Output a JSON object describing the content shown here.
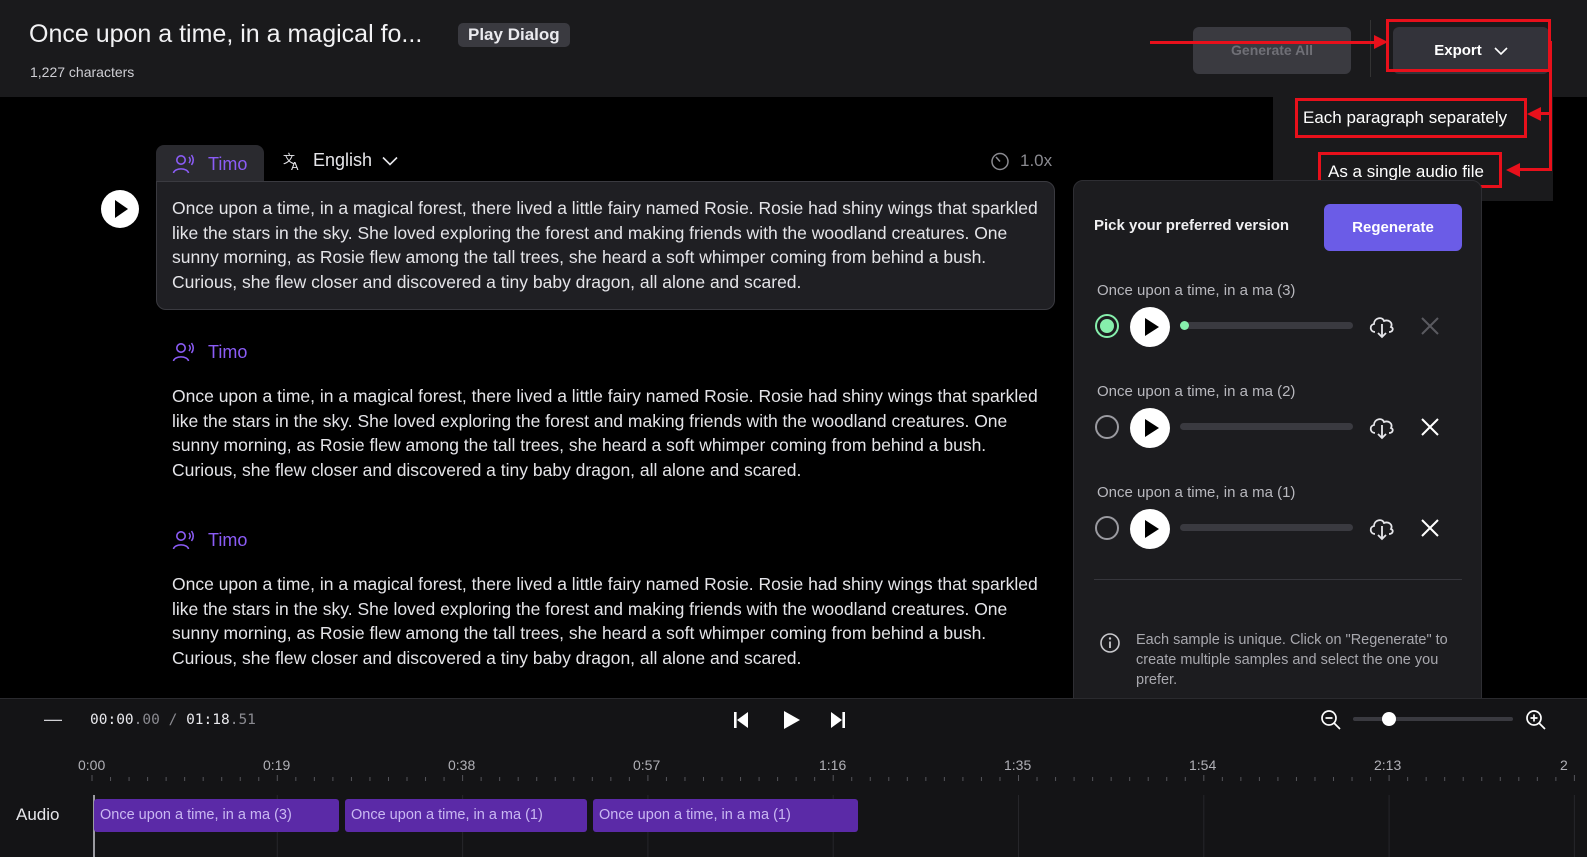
{
  "header": {
    "title": "Once upon a time, in a magical fo...",
    "badge": "Play Dialog",
    "char_count": "1,227 characters",
    "generate_all": "Generate All",
    "export": "Export"
  },
  "export_menu": {
    "items": [
      "Each paragraph separately",
      "As a single audio file"
    ]
  },
  "editor": {
    "language": "English",
    "speed": "1.0x",
    "paragraphs": [
      {
        "speaker": "Timo",
        "text": "Once upon a time, in a magical forest, there lived a little fairy named Rosie. Rosie had shiny wings that sparkled like the stars in the sky. She loved exploring the forest and making friends with the woodland creatures. One sunny morning, as Rosie flew among the tall trees, she heard a soft whimper coming from behind a bush. Curious, she flew closer and discovered a tiny baby dragon, all alone and scared."
      },
      {
        "speaker": "Timo",
        "text": "Once upon a time, in a magical forest, there lived a little fairy named Rosie. Rosie had shiny wings that sparkled like the stars in the sky. She loved exploring the forest and making friends with the woodland creatures. One sunny morning, as Rosie flew among the tall trees, she heard a soft whimper coming from behind a bush. Curious, she flew closer and discovered a tiny baby dragon, all alone and scared."
      },
      {
        "speaker": "Timo",
        "text": "Once upon a time, in a magical forest, there lived a little fairy named Rosie. Rosie had shiny wings that sparkled like the stars in the sky. She loved exploring the forest and making friends with the woodland creatures. One sunny morning, as Rosie flew among the tall trees, she heard a soft whimper coming from behind a bush. Curious, she flew closer and discovered a tiny baby dragon, all alone and scared."
      }
    ]
  },
  "versions": {
    "heading": "Pick your preferred version",
    "regenerate": "Regenerate",
    "items": [
      {
        "title": "Once upon a time, in a ma (3)",
        "selected": true,
        "progress": 0.0
      },
      {
        "title": "Once upon a time, in a ma (2)",
        "selected": false,
        "progress": 0.0
      },
      {
        "title": "Once upon a time, in a ma (1)",
        "selected": false,
        "progress": 0.0
      }
    ],
    "info": "Each sample is unique. Click on \"Regenerate\" to create multiple samples and select the one you prefer."
  },
  "timeline": {
    "collapse": "—",
    "current_main": "00:00",
    "current_frac": ".00",
    "separator": " / ",
    "total_main": "01:18",
    "total_frac": ".51",
    "zoom_level": 0.2,
    "ruler": [
      "0:00",
      "0:19",
      "0:38",
      "0:57",
      "1:16",
      "1:35",
      "1:54",
      "2:13",
      "2"
    ],
    "track_label": "Audio",
    "clips": [
      "Once upon a time, in a ma (3)",
      "Once upon a time, in a ma (1)",
      "Once upon a time, in a ma (1)"
    ]
  },
  "colors": {
    "accent": "#6b5ce7",
    "speaker": "#8b5cf6",
    "selected": "#86efac",
    "clip": "#5b2aa7",
    "annotation": "#e8101b"
  }
}
